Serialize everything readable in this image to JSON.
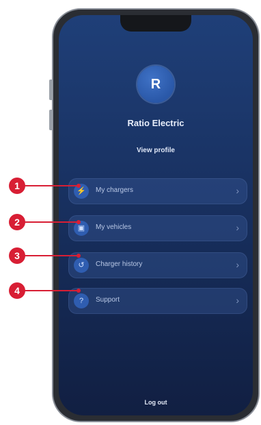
{
  "profile": {
    "avatar_initial": "R",
    "name": "Ratio Electric",
    "view_profile_label": "View profile"
  },
  "menu": [
    {
      "label": "My chargers",
      "icon": "charger-icon"
    },
    {
      "label": "My vehicles",
      "icon": "car-icon"
    },
    {
      "label": "Charger history",
      "icon": "history-icon"
    },
    {
      "label": "Support",
      "icon": "support-icon"
    }
  ],
  "footer": {
    "logout_label": "Log out"
  },
  "callouts": [
    "1",
    "2",
    "3",
    "4"
  ],
  "colors": {
    "callout": "#d81e34",
    "background_top": "#1f3f78",
    "background_bottom": "#111f42",
    "accent": "#2f5db0"
  }
}
